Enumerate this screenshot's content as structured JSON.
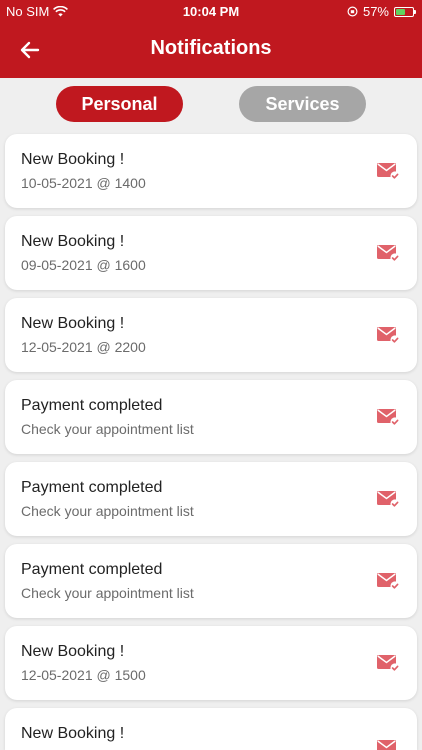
{
  "status_bar": {
    "carrier": "No SIM",
    "time": "10:04 PM",
    "battery": "57%",
    "battery_level": 0.57
  },
  "header": {
    "title": "Notifications",
    "back_icon": "arrow-left-icon"
  },
  "tabs": [
    {
      "label": "Personal",
      "active": true
    },
    {
      "label": "Services",
      "active": false
    }
  ],
  "notifications": [
    {
      "title": "New Booking !",
      "subtitle": "10-05-2021 @ 1400"
    },
    {
      "title": "New Booking !",
      "subtitle": "09-05-2021 @ 1600"
    },
    {
      "title": "New Booking !",
      "subtitle": "12-05-2021 @ 2200"
    },
    {
      "title": "Payment completed",
      "subtitle": "Check your appointment list"
    },
    {
      "title": "Payment completed",
      "subtitle": "Check your appointment list"
    },
    {
      "title": "Payment completed",
      "subtitle": "Check your appointment list"
    },
    {
      "title": "New Booking !",
      "subtitle": "12-05-2021 @ 1500"
    },
    {
      "title": "New Booking !",
      "subtitle": ""
    }
  ],
  "colors": {
    "primary": "#c0181f",
    "inactive_tab": "#a6a6a6",
    "icon": "#e0626a",
    "background": "#efefef"
  }
}
